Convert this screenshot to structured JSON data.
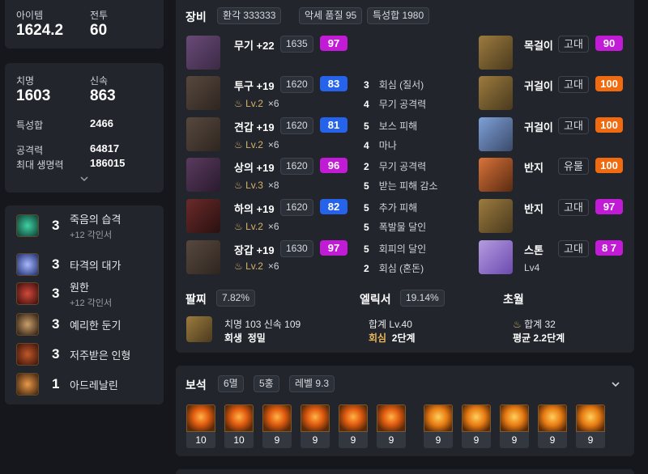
{
  "stats": {
    "item_level_label": "아이템",
    "item_level": "1624.2",
    "combat_label": "전투",
    "combat_level": "60",
    "crit_label": "치명",
    "crit": "1603",
    "swift_label": "신속",
    "swift": "863",
    "spec_sum_label": "특성합",
    "spec_sum": "2466",
    "attack_label": "공격력",
    "attack": "64817",
    "hp_label": "최대 생명력",
    "hp": "186015",
    "expand_icon": "chevron-down-icon"
  },
  "engravings": [
    {
      "num": "3",
      "name": "죽음의 습격",
      "sub": "+12 각인서",
      "icon": "death-strike-icon"
    },
    {
      "num": "3",
      "name": "타격의 대가",
      "sub": "",
      "icon": "hit-master-icon"
    },
    {
      "num": "3",
      "name": "원한",
      "sub": "+12 각인서",
      "icon": "grudge-icon"
    },
    {
      "num": "3",
      "name": "예리한 둔기",
      "sub": "",
      "icon": "keen-blunt-icon"
    },
    {
      "num": "3",
      "name": "저주받은 인형",
      "sub": "",
      "icon": "cursed-doll-icon"
    },
    {
      "num": "1",
      "name": "아드레날린",
      "sub": "",
      "icon": "adrenaline-icon"
    }
  ],
  "equipment": {
    "title": "장비",
    "chips": [
      "환각 333333",
      "악세 품질 95",
      "특성합 1980"
    ],
    "armor": [
      {
        "name": "무기 +22",
        "level": "1635",
        "quality": "97",
        "color": "#c21bd6",
        "sub": "",
        "mult": "",
        "icon": "weapon-icon"
      },
      {
        "name": "투구 +19",
        "level": "1620",
        "quality": "83",
        "color": "#2563eb",
        "sub": "Lv.2",
        "mult": "×6",
        "icon": "helmet-icon"
      },
      {
        "name": "견갑 +19",
        "level": "1620",
        "quality": "81",
        "color": "#2563eb",
        "sub": "Lv.2",
        "mult": "×6",
        "icon": "shoulder-icon"
      },
      {
        "name": "상의 +19",
        "level": "1620",
        "quality": "96",
        "color": "#c21bd6",
        "sub": "Lv.3",
        "mult": "×8",
        "icon": "chest-icon"
      },
      {
        "name": "하의 +19",
        "level": "1620",
        "quality": "82",
        "color": "#2563eb",
        "sub": "Lv.2",
        "mult": "×6",
        "icon": "pants-icon"
      },
      {
        "name": "장갑 +19",
        "level": "1630",
        "quality": "97",
        "color": "#c21bd6",
        "sub": "Lv.2",
        "mult": "×6",
        "icon": "gloves-icon"
      }
    ],
    "effects": [
      {
        "n": "3",
        "t": "회심 (질서)"
      },
      {
        "n": "4",
        "t": "무기 공격력"
      },
      {
        "n": "5",
        "t": "보스 피해"
      },
      {
        "n": "4",
        "t": "마나"
      },
      {
        "n": "2",
        "t": "무기 공격력"
      },
      {
        "n": "5",
        "t": "받는 피해 감소"
      },
      {
        "n": "5",
        "t": "추가 피해"
      },
      {
        "n": "5",
        "t": "폭발물 달인"
      },
      {
        "n": "5",
        "t": "회피의 달인"
      },
      {
        "n": "2",
        "t": "회심 (혼돈)"
      }
    ],
    "accessories": [
      {
        "name": "목걸이",
        "grade": "고대",
        "quality": "90",
        "color": "#c21bd6",
        "icon": "necklace-icon"
      },
      {
        "name": "귀걸이",
        "grade": "고대",
        "quality": "100",
        "color": "#f06a10",
        "icon": "earring-icon"
      },
      {
        "name": "귀걸이",
        "grade": "고대",
        "quality": "100",
        "color": "#f06a10",
        "icon": "earring-icon"
      },
      {
        "name": "반지",
        "grade": "유물",
        "quality": "100",
        "color": "#f06a10",
        "icon": "ring-icon"
      },
      {
        "name": "반지",
        "grade": "고대",
        "quality": "97",
        "color": "#c21bd6",
        "icon": "ring-icon"
      },
      {
        "name": "스톤",
        "grade": "고대",
        "quality": "8 7",
        "color": "#c21bd6",
        "sub": "Lv4",
        "icon": "stone-icon"
      }
    ]
  },
  "bracelet": {
    "title": "팔찌",
    "pct": "7.82%",
    "line1": "치명 103  신속 109",
    "line2a": "회생",
    "line2b": "정밀",
    "icon": "bracelet-icon"
  },
  "elixir": {
    "title": "엘릭서",
    "pct": "19.14%",
    "line1": "합계 Lv.40",
    "line2a": "회심",
    "line2b": "2단계"
  },
  "transcend": {
    "title": "초월",
    "line1": "합계 32",
    "line2": "평균 2.2단계"
  },
  "gems": {
    "title": "보석",
    "chips": [
      "6멸",
      "5홍",
      "레벨 9.3"
    ],
    "values": [
      "10",
      "10",
      "9",
      "9",
      "9",
      "9",
      "9",
      "9",
      "9",
      "9",
      "9"
    ]
  }
}
